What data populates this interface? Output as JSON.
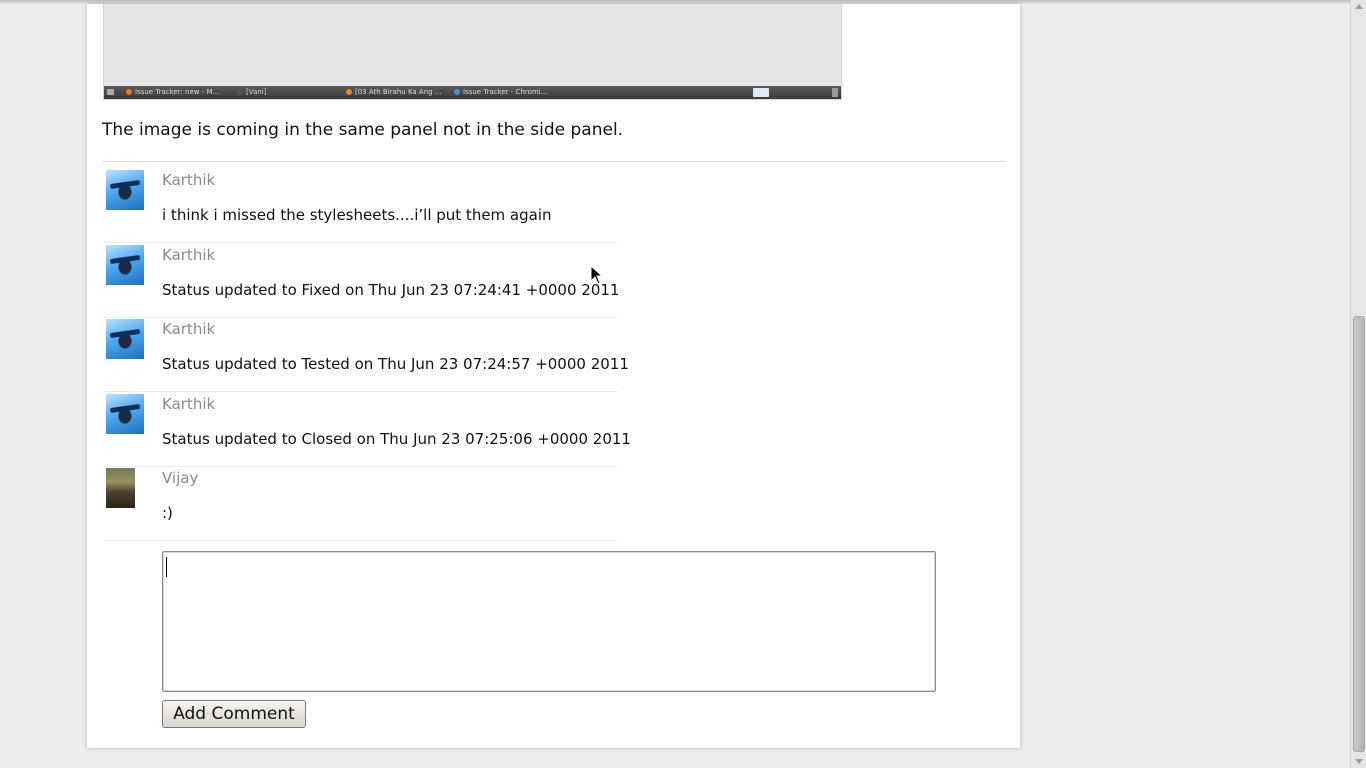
{
  "screenshot": {
    "taskbar_items": [
      "Issue Tracker: new - M...",
      "[Vani]",
      "[03 Ath Birahu Ka Ang ...",
      "Issue Tracker - Chromi..."
    ]
  },
  "description": "The image is coming in the same panel not in the side panel.",
  "comments": [
    {
      "author": "Karthik",
      "text": "i think i missed the stylesheets....i’ll put them again"
    },
    {
      "author": "Karthik",
      "text": "Status updated to Fixed on Thu Jun 23 07:24:41 +0000 2011"
    },
    {
      "author": "Karthik",
      "text": "Status updated to Tested on Thu Jun 23 07:24:57 +0000 2011"
    },
    {
      "author": "Karthik",
      "text": "Status updated to Closed on Thu Jun 23 07:25:06 +0000 2011"
    },
    {
      "author": "Vijay",
      "text": ":)"
    }
  ],
  "comment_form": {
    "value": "",
    "button_label": "Add Comment"
  },
  "colors": {
    "page_background": "#ececec",
    "content_background": "#ffffff",
    "author_text": "#8a8a8a"
  }
}
